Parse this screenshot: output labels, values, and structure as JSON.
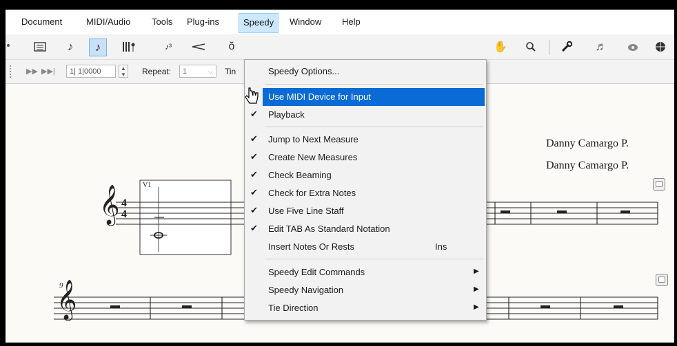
{
  "menubar": {
    "items": [
      "Document",
      "MIDI/Audio",
      "Tools",
      "Plug-ins",
      "Speedy",
      "Window",
      "Help"
    ]
  },
  "toolbar2": {
    "position_value": "1| 1|0000",
    "repeat_label": "Repeat:",
    "repeat_value": "1",
    "tin_fragment": "Tin"
  },
  "score": {
    "composer_1": "Danny Camargo P.",
    "composer_2": "Danny Camargo P.",
    "voice_label": "V1",
    "measure_number": "9"
  },
  "speedy_menu": {
    "options": "Speedy Options...",
    "use_midi": "Use MIDI Device for Input",
    "playback": "Playback",
    "jump": "Jump to Next Measure",
    "create": "Create New Measures",
    "beaming": "Check Beaming",
    "extra": "Check for Extra Notes",
    "five_line": "Use Five Line Staff",
    "edit_tab": "Edit TAB As Standard Notation",
    "insert": "Insert Notes Or Rests",
    "insert_shortcut": "Ins",
    "edit_commands": "Speedy Edit Commands",
    "navigation": "Speedy Navigation",
    "tie": "Tie Direction"
  }
}
